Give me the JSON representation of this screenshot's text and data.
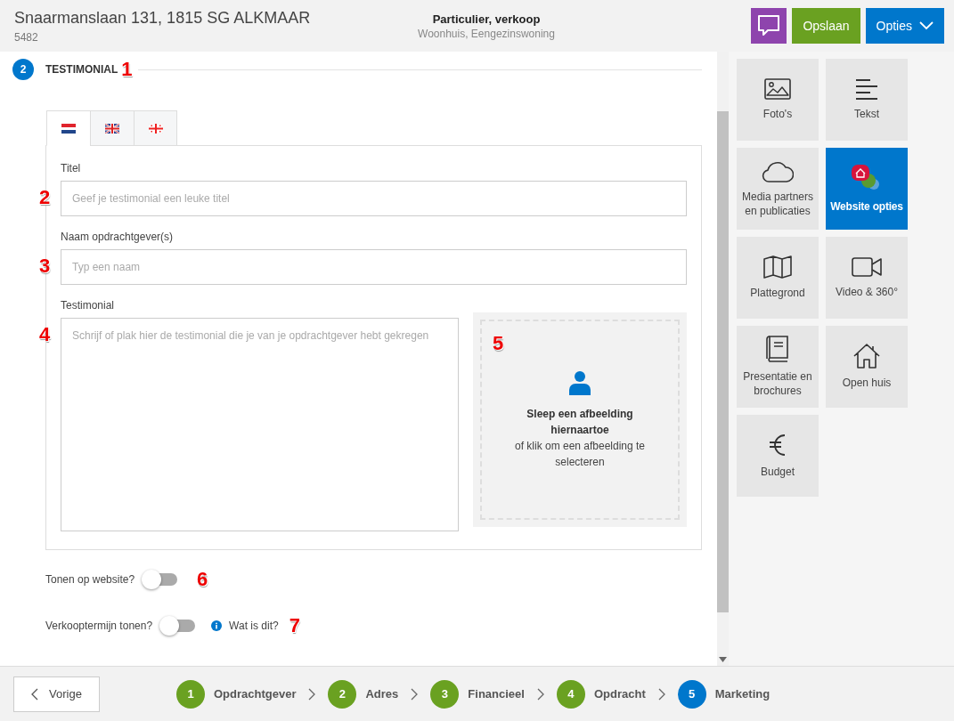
{
  "header": {
    "address": "Snaarmanslaan 131, 1815 SG ALKMAAR",
    "number": "5482",
    "type": "Particulier, verkoop",
    "subtype": "Woonhuis, Eengezinswoning",
    "save": "Opslaan",
    "options": "Opties"
  },
  "section": {
    "number": "2",
    "title": "TESTIMONIAL",
    "callout": "1"
  },
  "tabs": [
    {
      "kind": "nl",
      "selected": true
    },
    {
      "kind": "uk",
      "selected": false
    },
    {
      "kind": "ge",
      "selected": false
    }
  ],
  "fields": [
    {
      "label": "Titel",
      "placeholder": "Geef je testimonial een leuke titel",
      "callout": "2"
    },
    {
      "label": "Naam opdrachtgever(s)",
      "placeholder": "Typ een naam",
      "callout": "3"
    }
  ],
  "testimonial": {
    "label": "Testimonial",
    "placeholder": "Schrijf of plak hier de testimonial die je van je opdrachtgever hebt gekregen",
    "callout": "4"
  },
  "dropzone": {
    "title": "Sleep een afbeelding hiernaartoe",
    "hint": "of klik om een afbeelding te selecteren",
    "callout": "5"
  },
  "toggles": [
    {
      "label": "Tonen op website?",
      "on": false,
      "callout": "6"
    },
    {
      "label": "Verkooptermijn tonen?",
      "on": false,
      "link": "Wat is dit?",
      "callout": "7"
    }
  ],
  "tiles": [
    {
      "kind": "photo",
      "label": "Foto's",
      "selected": false
    },
    {
      "kind": "text",
      "label": "Tekst",
      "selected": false
    },
    {
      "kind": "cloud",
      "label": "Media partners en publicaties",
      "selected": false
    },
    {
      "kind": "website",
      "label": "Website opties",
      "selected": true
    },
    {
      "kind": "map",
      "label": "Plattegrond",
      "selected": false
    },
    {
      "kind": "video",
      "label": "Video & 360°",
      "selected": false
    },
    {
      "kind": "book",
      "label": "Presentatie en brochures",
      "selected": false
    },
    {
      "kind": "house",
      "label": "Open huis",
      "selected": false
    },
    {
      "kind": "euro",
      "label": "Budget",
      "selected": false
    }
  ],
  "footer": {
    "back": "Vorige",
    "steps": [
      {
        "number": "1",
        "label": "Opdrachtgever",
        "selected": false
      },
      {
        "number": "2",
        "label": "Adres",
        "selected": false
      },
      {
        "number": "3",
        "label": "Financieel",
        "selected": false
      },
      {
        "number": "4",
        "label": "Opdracht",
        "selected": false
      },
      {
        "number": "5",
        "label": "Marketing",
        "selected": true
      }
    ]
  }
}
